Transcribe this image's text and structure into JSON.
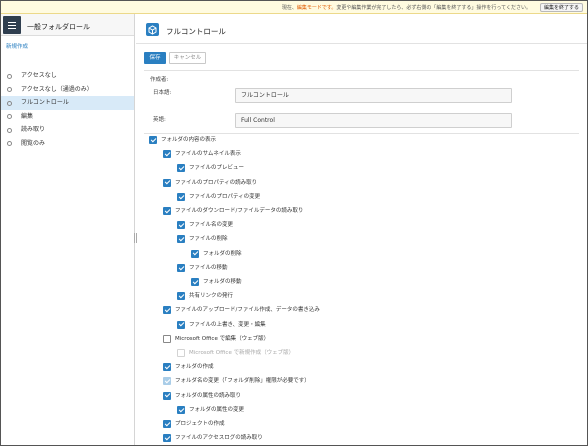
{
  "notice": {
    "prefix": "現在、",
    "highlight": "編集モードです。",
    "suffix": "変更や編集作業が完了したら、必ず右側の「編集を終了する」操作を行ってください。",
    "end_button": "編集を終了する"
  },
  "sidebar": {
    "title": "一般フォルダロール",
    "new_link": "新規作成",
    "items": [
      {
        "label": "アクセスなし",
        "active": false
      },
      {
        "label": "アクセスなし（通過のみ）",
        "active": false
      },
      {
        "label": "フルコントロール",
        "active": true
      },
      {
        "label": "編集",
        "active": false
      },
      {
        "label": "読み取り",
        "active": false
      },
      {
        "label": "閲覧のみ",
        "active": false
      }
    ]
  },
  "main": {
    "title": "フルコントロール",
    "save_label": "保存",
    "cancel_label": "キャンセル",
    "name_label": "作成者:",
    "jp_label": "日本語:",
    "jp_value": "フルコントロール",
    "en_label": "英語:",
    "en_value": "Full Control"
  },
  "permissions": [
    {
      "label": "フォルダの内容の表示",
      "level": 0,
      "state": "on"
    },
    {
      "label": "ファイルのサムネイル表示",
      "level": 1,
      "state": "on"
    },
    {
      "label": "ファイルのプレビュー",
      "level": 2,
      "state": "on"
    },
    {
      "label": "ファイルのプロパティの読み取り",
      "level": 1,
      "state": "on"
    },
    {
      "label": "ファイルのプロパティの変更",
      "level": 2,
      "state": "on"
    },
    {
      "label": "ファイルのダウンロード/ファイルデータの読み取り",
      "level": 1,
      "state": "on"
    },
    {
      "label": "ファイル名の変更",
      "level": 2,
      "state": "on"
    },
    {
      "label": "ファイルの削除",
      "level": 2,
      "state": "on"
    },
    {
      "label": "フォルダの削除",
      "level": 3,
      "state": "on"
    },
    {
      "label": "ファイルの移動",
      "level": 2,
      "state": "on"
    },
    {
      "label": "フォルダの移動",
      "level": 3,
      "state": "on"
    },
    {
      "label": "共有リンクの発行",
      "level": 2,
      "state": "on"
    },
    {
      "label": "ファイルのアップロード/ファイル作成、データの書き込み",
      "level": 1,
      "state": "on"
    },
    {
      "label": "ファイルの上書き、変更・編集",
      "level": 2,
      "state": "on"
    },
    {
      "label": "Microsoft Office で編集（ウェブ版）",
      "level": 1,
      "state": "off"
    },
    {
      "label": "Microsoft Office で新規作成（ウェブ版）",
      "level": 2,
      "state": "faint"
    },
    {
      "label": "フォルダの作成",
      "level": 1,
      "state": "on"
    },
    {
      "label": "フォルダ名の変更（「フォルダ削除」権限が必要です）",
      "level": 1,
      "state": "dim"
    },
    {
      "label": "フォルダの属性の読み取り",
      "level": 1,
      "state": "on"
    },
    {
      "label": "フォルダの属性の変更",
      "level": 2,
      "state": "on"
    },
    {
      "label": "プロジェクトの作成",
      "level": 1,
      "state": "on"
    },
    {
      "label": "ファイルのアクセスログの読み取り",
      "level": 1,
      "state": "on"
    }
  ],
  "colors": {
    "accent": "#2a7fc1",
    "notice_bg": "#fffbe0",
    "notice_highlight": "#e05a00",
    "active_item_bg": "#d8eaf8",
    "menu_bg": "#2f3e4f"
  }
}
